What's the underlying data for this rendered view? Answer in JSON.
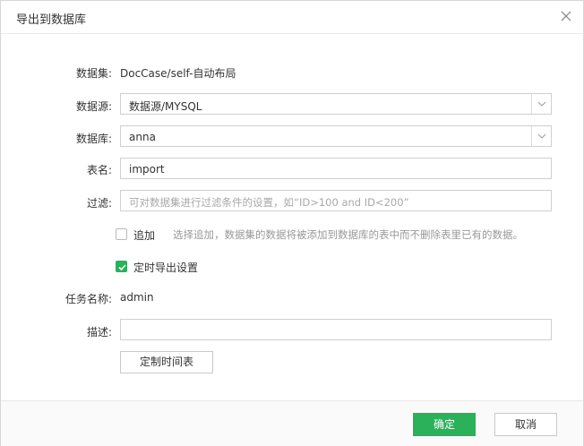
{
  "dialog": {
    "title": "导出到数据库"
  },
  "form": {
    "dataset": {
      "label": "数据集:",
      "value": "DocCase/self-自动布局"
    },
    "datasource": {
      "label": "数据源:",
      "value": "数据源/MYSQL"
    },
    "database": {
      "label": "数据库:",
      "value": "anna"
    },
    "table_name": {
      "label": "表名:",
      "value": "import"
    },
    "filter": {
      "label": "过滤:",
      "placeholder": "可对数据集进行过滤条件的设置，如“ID>100 and ID<200”"
    },
    "append": {
      "label": "追加",
      "checked": false,
      "hint": "选择追加，数据集的数据将被添加到数据库的表中而不删除表里已有的数据。"
    },
    "scheduled": {
      "label": "定时导出设置",
      "checked": true
    },
    "task_name": {
      "label": "任务名称:",
      "value": "admin"
    },
    "description": {
      "label": "描述:",
      "value": ""
    },
    "schedule_button": "定制时间表"
  },
  "footer": {
    "ok_label": "确定",
    "cancel_label": "取消"
  },
  "colors": {
    "accent": "#2ab15a",
    "border": "#cfcfcf",
    "hint": "#999999"
  },
  "icons": {
    "close": "close-icon",
    "dropdown": "chevron-down-icon",
    "check": "check-icon"
  }
}
